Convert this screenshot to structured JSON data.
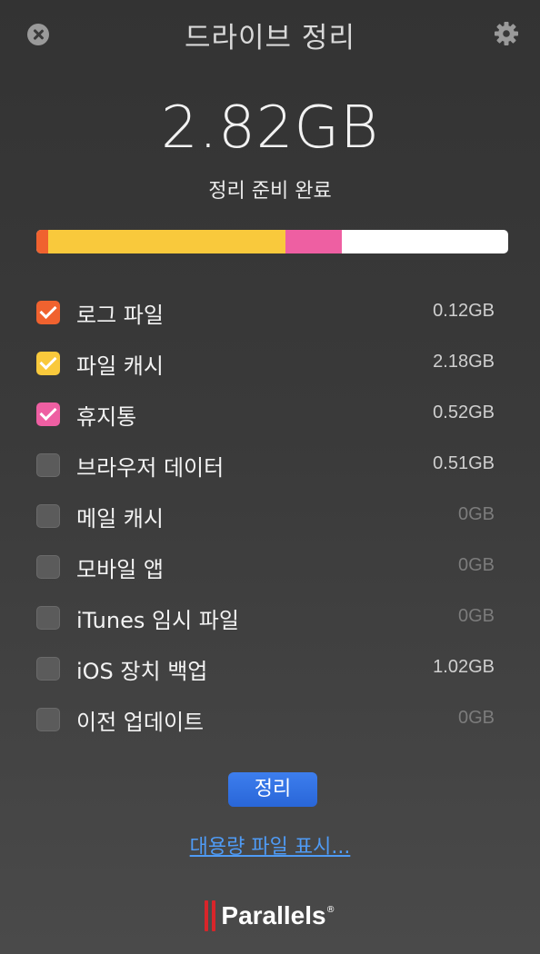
{
  "window": {
    "title": "드라이브 정리"
  },
  "summary": {
    "total": "2.82GB",
    "status": "정리 준비 완료"
  },
  "usage_bar": {
    "segments": [
      {
        "name": "로그 파일",
        "fraction": 0.0259,
        "color": "#f0622f"
      },
      {
        "name": "파일 캐시",
        "fraction": 0.5026,
        "color": "#f9c93c"
      },
      {
        "name": "휴지통",
        "fraction": 0.1192,
        "color": "#ee5fa2"
      }
    ],
    "empty_color": "#ffffff"
  },
  "items": [
    {
      "label": "로그 파일",
      "size": "0.12GB",
      "checked": true,
      "color": "#f0622f",
      "zero": false
    },
    {
      "label": "파일 캐시",
      "size": "2.18GB",
      "checked": true,
      "color": "#f9c93c",
      "zero": false
    },
    {
      "label": "휴지통",
      "size": "0.52GB",
      "checked": true,
      "color": "#ee5fa2",
      "zero": false
    },
    {
      "label": "브라우저 데이터",
      "size": "0.51GB",
      "checked": false,
      "color": "#5b5b5b",
      "zero": false
    },
    {
      "label": "메일 캐시",
      "size": "0GB",
      "checked": false,
      "color": "#5b5b5b",
      "zero": true
    },
    {
      "label": "모바일 앱",
      "size": "0GB",
      "checked": false,
      "color": "#5b5b5b",
      "zero": true
    },
    {
      "label": "iTunes 임시 파일",
      "size": "0GB",
      "checked": false,
      "color": "#5b5b5b",
      "zero": true
    },
    {
      "label": "iOS 장치 백업",
      "size": "1.02GB",
      "checked": false,
      "color": "#5b5b5b",
      "zero": false
    },
    {
      "label": "이전 업데이트",
      "size": "0GB",
      "checked": false,
      "color": "#5b5b5b",
      "zero": true
    }
  ],
  "actions": {
    "clean_label": "정리",
    "large_files_link": "대용량 파일 표시..."
  },
  "footer": {
    "brand": "Parallels",
    "mark": "®"
  },
  "icons": {
    "close": "close-icon",
    "settings": "gear-icon",
    "brand": "parallels-logo-icon"
  }
}
